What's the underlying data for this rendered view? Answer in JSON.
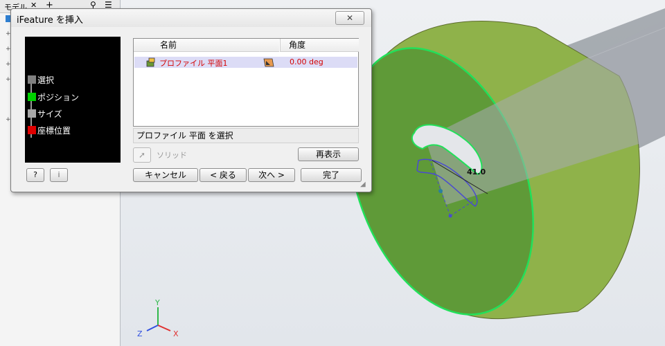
{
  "browser": {
    "title": "モデル",
    "tab_close": "✕",
    "tab_add": "+",
    "search_icon": "⚲",
    "menu_icon": "☰",
    "expand_markers": [
      "+",
      "+",
      "+",
      "+",
      "+"
    ]
  },
  "dialog": {
    "title": "iFeature を挿入",
    "close_label": "✕",
    "preview_steps": [
      {
        "label": "選択",
        "color": "#808080"
      },
      {
        "label": "ポジション",
        "color": "#00d200"
      },
      {
        "label": "サイズ",
        "color": "#a8a8a8"
      },
      {
        "label": "座標位置",
        "color": "#e00000"
      }
    ],
    "help_icon": "?",
    "info_icon": "i",
    "table": {
      "columns": [
        "名前",
        "角度"
      ],
      "rows": [
        {
          "name": "プロファイル 平面1",
          "angle": "0.00 deg"
        }
      ]
    },
    "status_text": "プロファイル 平面 を選択",
    "solid_label": "ソリッド",
    "redisplay_label": "再表示",
    "cancel_label": "キャンセル",
    "back_label": "< 戻る",
    "next_label": "次へ >",
    "finish_label": "完了"
  },
  "viewport": {
    "dimension_label": "41.0",
    "axis_labels": {
      "x": "X",
      "y": "Y",
      "z": "Z"
    },
    "colors": {
      "body": "#8fb24a",
      "face": "#5f9a38",
      "edge_highlight": "#22e05a",
      "sketch": "#4a4ad0"
    }
  }
}
